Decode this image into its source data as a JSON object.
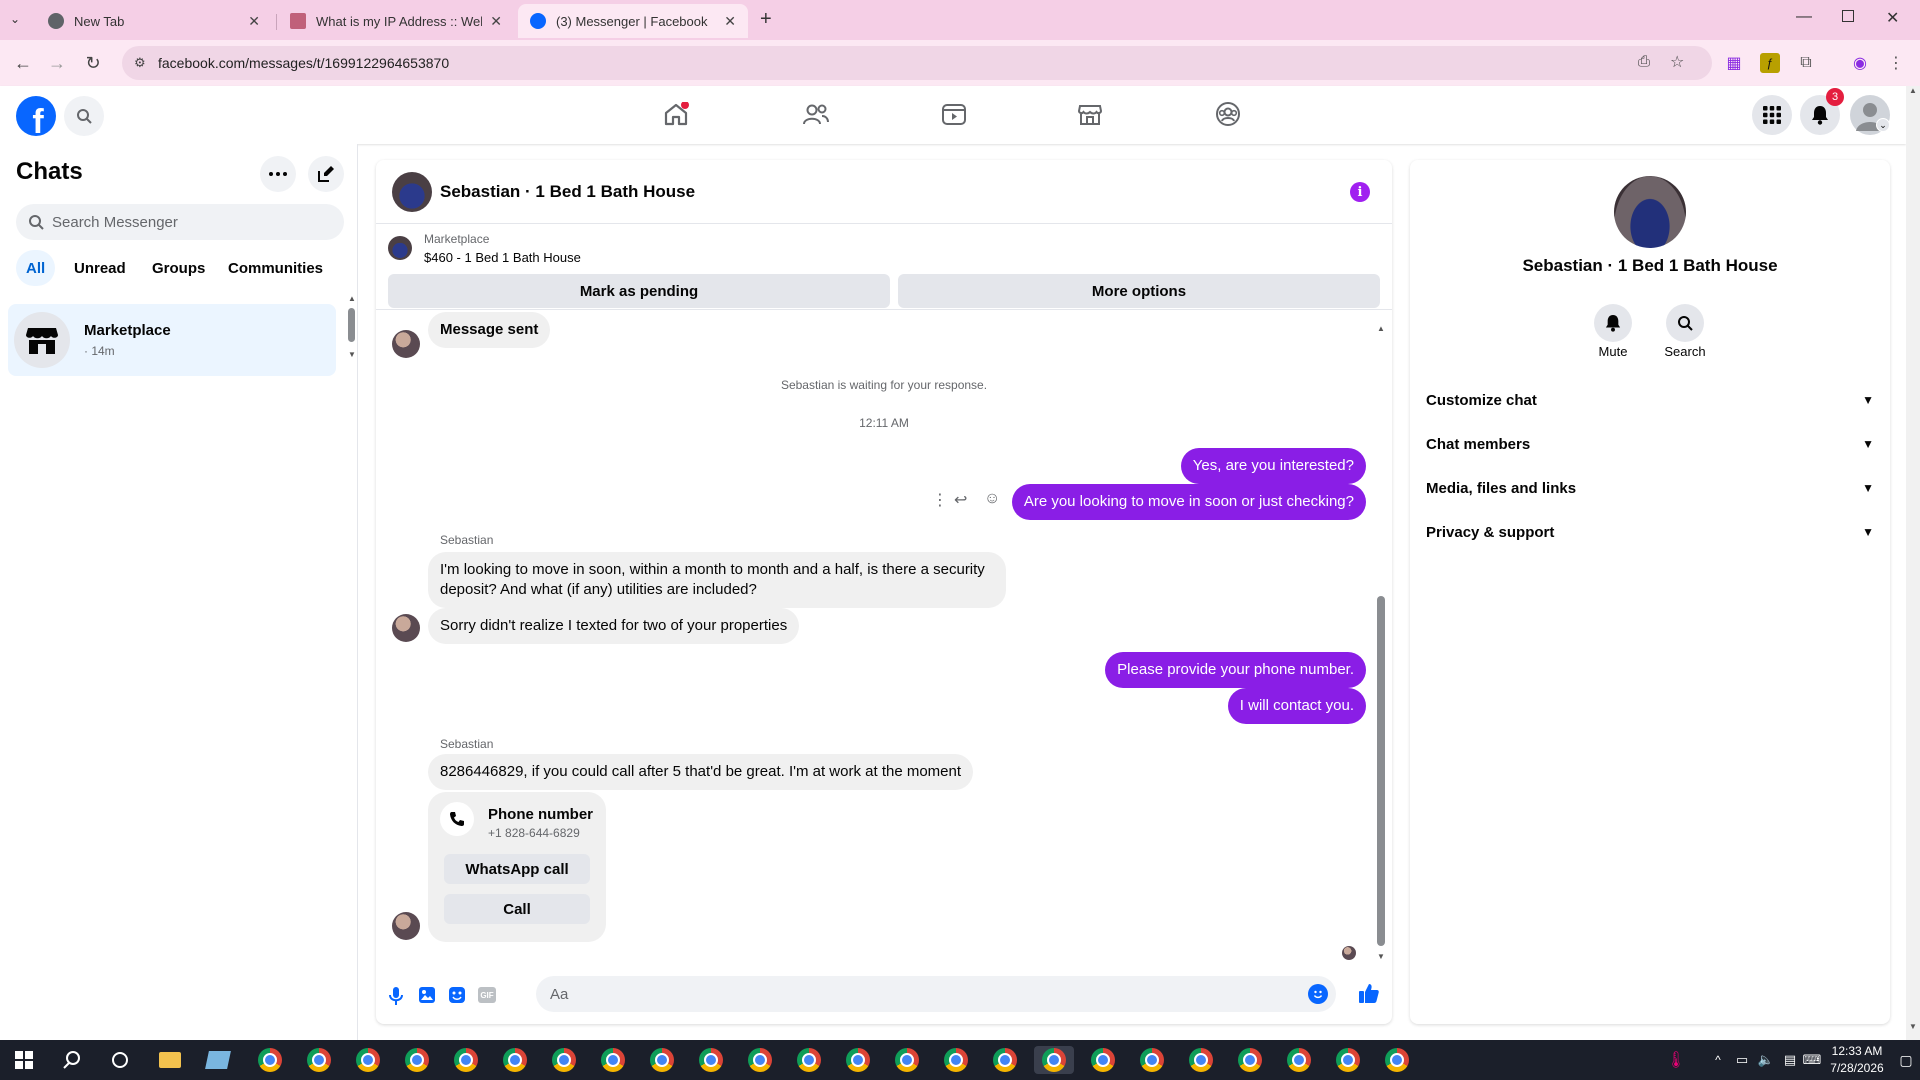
{
  "browser": {
    "tabs": [
      {
        "title": "New Tab",
        "favicon_color": "#5f6368"
      },
      {
        "title": "What is my IP Address :: WebBr",
        "favicon_color": "#b44"
      },
      {
        "title": "(3) Messenger | Facebook",
        "favicon_color": "#0866ff"
      }
    ],
    "url": "facebook.com/messages/t/1699122964653870"
  },
  "fb": {
    "notification_count": "3"
  },
  "left": {
    "title": "Chats",
    "search_placeholder": "Search Messenger",
    "filters": [
      "All",
      "Unread",
      "Groups",
      "Communities"
    ],
    "chat": {
      "name": "Marketplace",
      "time": "· 14m"
    }
  },
  "chat": {
    "title": "Sebastian · 1 Bed 1 Bath House",
    "listing_source": "Marketplace",
    "listing_title": "$460 - 1 Bed 1 Bath House",
    "mark_pending": "Mark as pending",
    "more_options": "More options",
    "msg_sent": "Message sent",
    "waiting": "Sebastian is waiting for your response.",
    "timestamp": "12:11 AM",
    "out1": "Yes, are you interested?",
    "out2": "Are you looking to move in soon or just checking?",
    "sender1": "Sebastian",
    "in1": "I'm looking to move in soon, within a month to month and a half, is there a security deposit? And what (if any) utilities are included?",
    "in2": "Sorry didn't realize I texted for two of your properties",
    "out3": "Please provide your phone number.",
    "out4": "I will contact you.",
    "sender2": "Sebastian",
    "in3": "8286446829, if you could call after 5 that'd be great. I'm at work at the moment",
    "phone_card": {
      "title": "Phone number",
      "number": "+1 828-644-6829",
      "whatsapp": "WhatsApp call",
      "call": "Call"
    },
    "input_placeholder": "Aa"
  },
  "right": {
    "name": "Sebastian · 1 Bed 1 Bath House",
    "mute": "Mute",
    "search": "Search",
    "sections": [
      "Customize chat",
      "Chat members",
      "Media, files and links",
      "Privacy & support"
    ]
  },
  "taskbar": {
    "time": "12:33 AM",
    "date": "7/28/2026"
  },
  "colors": {
    "accent": "#8a1ee6",
    "fb_blue": "#0866ff",
    "info": "#a020f0"
  }
}
